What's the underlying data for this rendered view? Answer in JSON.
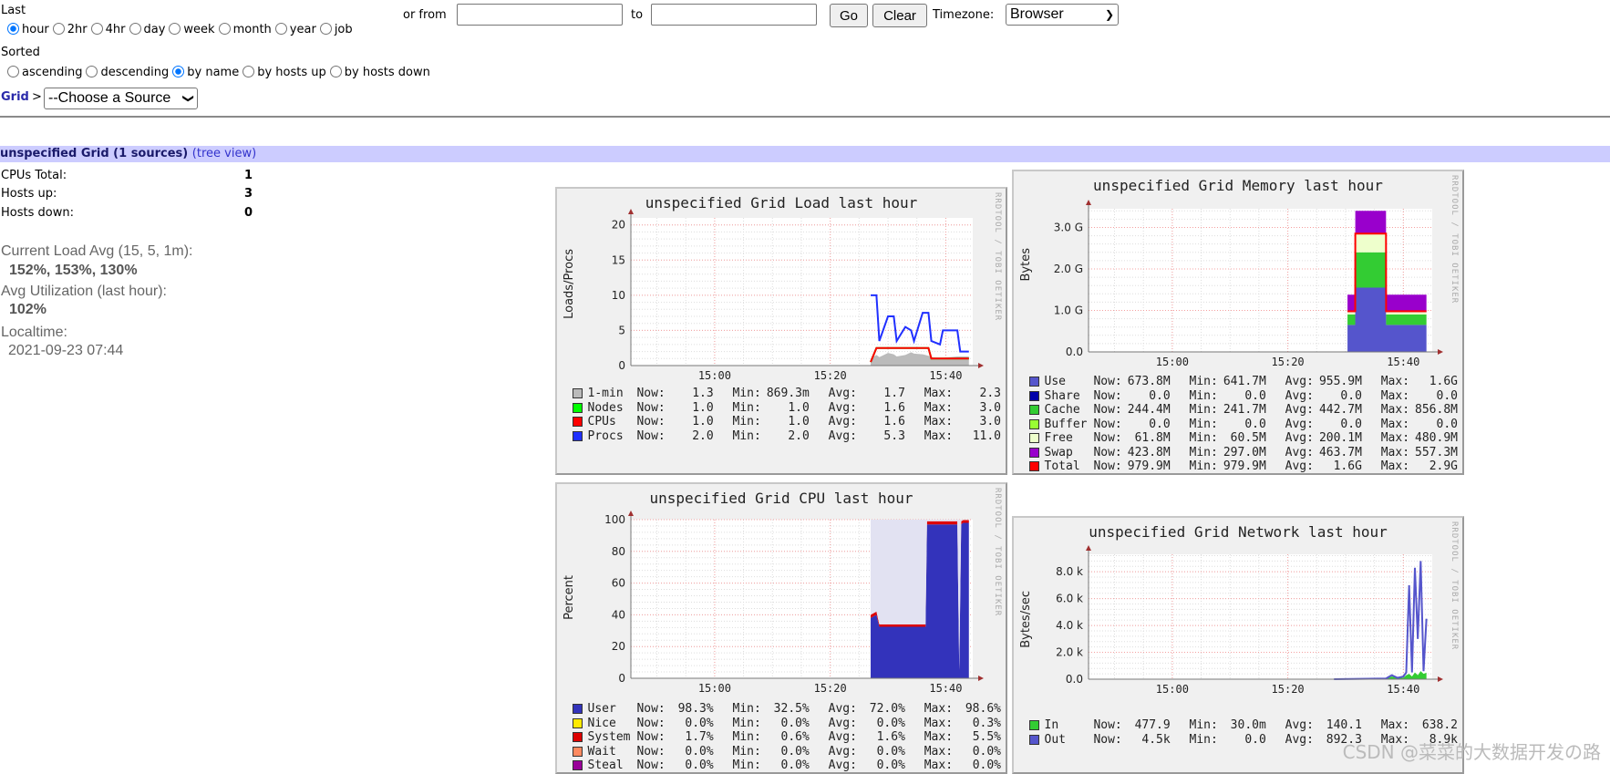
{
  "controls": {
    "last_label": "Last",
    "ranges": [
      {
        "label": "hour",
        "checked": true
      },
      {
        "label": "2hr",
        "checked": false
      },
      {
        "label": "4hr",
        "checked": false
      },
      {
        "label": "day",
        "checked": false
      },
      {
        "label": "week",
        "checked": false
      },
      {
        "label": "month",
        "checked": false
      },
      {
        "label": "year",
        "checked": false
      },
      {
        "label": "job",
        "checked": false
      }
    ],
    "or_from_label": "or from",
    "from_value": "",
    "to_label": "to",
    "to_value": "",
    "go_label": "Go",
    "clear_label": "Clear",
    "timezone_label": "Timezone:",
    "timezone_value": "Browser",
    "sorted_label": "Sorted",
    "sorts": [
      {
        "label": "ascending",
        "checked": false
      },
      {
        "label": "descending",
        "checked": false
      },
      {
        "label": "by name",
        "checked": true
      },
      {
        "label": "by hosts up",
        "checked": false
      },
      {
        "label": "by hosts down",
        "checked": false
      }
    ],
    "grid_link": "Grid",
    "breadcrumb_sep": ">",
    "source_select": "--Choose a Source"
  },
  "grid": {
    "header": "unspecified Grid (1 sources)",
    "tree_view": "(tree view)",
    "stats": [
      {
        "label": "CPUs Total:",
        "value": "1"
      },
      {
        "label": "Hosts up:",
        "value": "3"
      },
      {
        "label": "Hosts down:",
        "value": "0"
      }
    ],
    "load_label": "Current Load Avg (15, 5, 1m):",
    "load_value": "152%, 153%, 130%",
    "util_label": "Avg Utilization (last hour):",
    "util_value": "102%",
    "localtime_label": "Localtime:",
    "localtime_value": "2021-09-23 07:44"
  },
  "graphs": {
    "watermark_side": "RRDTOOL / TOBI OETIKER",
    "legend_labels": {
      "now": "Now:",
      "min": "Min:",
      "avg": "Avg:",
      "max": "Max:"
    },
    "load": {
      "title": "unspecified Grid Load last hour",
      "ylabel": "Loads/Procs",
      "ylim": [
        0,
        21
      ],
      "yticks": [
        "0",
        "5",
        "10",
        "15",
        "20"
      ],
      "ytick_values": [
        0,
        5,
        10,
        15,
        20
      ],
      "xticks": [
        "15:00",
        "15:20",
        "15:40"
      ],
      "xlim": [
        "14:45:30",
        "15:44:40"
      ],
      "times": [
        "15:27",
        "15:28",
        "15:28:30",
        "15:30",
        "15:31",
        "15:31:30",
        "15:33",
        "15:34",
        "15:34:30",
        "15:36",
        "15:37",
        "15:37:30",
        "15:39",
        "15:39:30",
        "15:42",
        "15:42:30",
        "15:44"
      ],
      "series": [
        {
          "name": "1-min",
          "color": "#bbbbbb",
          "style": "area",
          "values": [
            1,
            1.5,
            1.2,
            1.8,
            1.6,
            1.3,
            1.5,
            1.9,
            1.7,
            1.6,
            1.4,
            1.2,
            1,
            1.1,
            1.3,
            1.3,
            1.3
          ]
        },
        {
          "name": "Nodes",
          "color": "#00ff00",
          "style": "line",
          "values": [
            0.5,
            2.5,
            2.5,
            2.5,
            2.5,
            2.5,
            2.5,
            2.5,
            2.5,
            2.5,
            2.5,
            1,
            1,
            1,
            1,
            1,
            1
          ]
        },
        {
          "name": "CPUs",
          "color": "#ff0000",
          "style": "line",
          "values": [
            0.5,
            2.5,
            2.5,
            2.5,
            2.5,
            2.5,
            2.5,
            2.5,
            2.5,
            2.5,
            2.5,
            1,
            1,
            1,
            1,
            1,
            1
          ]
        },
        {
          "name": "Procs",
          "color": "#2030ff",
          "style": "line",
          "values": [
            10,
            10,
            3.5,
            7,
            7,
            3.5,
            5.5,
            5,
            3.5,
            7.5,
            7.5,
            3.5,
            3,
            5,
            5,
            2,
            2
          ]
        }
      ],
      "legend": [
        {
          "name": "1-min",
          "color": "#bbbbbb",
          "now": "1.3",
          "min": "869.3m",
          "avg": "1.7",
          "max": "2.3"
        },
        {
          "name": "Nodes",
          "color": "#00ff00",
          "now": "1.0",
          "min": "1.0",
          "avg": "1.6",
          "max": "3.0"
        },
        {
          "name": "CPUs",
          "color": "#ff0000",
          "now": "1.0",
          "min": "1.0",
          "avg": "1.6",
          "max": "3.0"
        },
        {
          "name": "Procs",
          "color": "#2030ff",
          "now": "2.0",
          "min": "2.0",
          "avg": "5.3",
          "max": "11.0"
        }
      ]
    },
    "memory": {
      "title": "unspecified Grid Memory last hour",
      "ylabel": "Bytes",
      "ylim": [
        0,
        3.45
      ],
      "yticks": [
        "0.0",
        "1.0 G",
        "2.0 G",
        "3.0 G"
      ],
      "ytick_values": [
        0,
        1,
        2,
        3
      ],
      "xticks": [
        "15:00",
        "15:20",
        "15:40"
      ],
      "xlim": [
        "14:45:30",
        "15:45:00"
      ],
      "times": [
        "15:30:20",
        "15:31:40",
        "15:31:41",
        "15:37:00",
        "15:37:01",
        "15:44:00"
      ],
      "series": [
        {
          "name": "Use",
          "color": "#5555cc",
          "style": "stack",
          "values": [
            0.65,
            0.65,
            1.55,
            1.55,
            0.65,
            0.65
          ]
        },
        {
          "name": "Cache",
          "color": "#33cc33",
          "style": "stack",
          "values": [
            0.25,
            0.25,
            0.85,
            0.85,
            0.25,
            0.25
          ]
        },
        {
          "name": "Free",
          "color": "#eeffcc",
          "style": "stack",
          "values": [
            0.06,
            0.06,
            0.45,
            0.45,
            0.06,
            0.06
          ]
        },
        {
          "name": "Swap",
          "color": "#9900cc",
          "style": "stack",
          "values": [
            0.42,
            0.42,
            0.55,
            0.55,
            0.42,
            0.42
          ]
        },
        {
          "name": "Total",
          "color": "#ff0000",
          "style": "line",
          "values": [
            0.98,
            0.98,
            2.85,
            2.85,
            0.98,
            0.98
          ]
        }
      ],
      "legend": [
        {
          "name": "Use",
          "color": "#5555cc",
          "now": "673.8M",
          "min": "641.7M",
          "avg": "955.9M",
          "max": "1.6G"
        },
        {
          "name": "Share",
          "color": "#0000aa",
          "now": "0.0",
          "min": "0.0",
          "avg": "0.0",
          "max": "0.0"
        },
        {
          "name": "Cache",
          "color": "#33cc33",
          "now": "244.4M",
          "min": "241.7M",
          "avg": "442.7M",
          "max": "856.8M"
        },
        {
          "name": "Buffer",
          "color": "#99ff33",
          "now": "0.0",
          "min": "0.0",
          "avg": "0.0",
          "max": "0.0"
        },
        {
          "name": "Free",
          "color": "#eeffcc",
          "now": "61.8M",
          "min": "60.5M",
          "avg": "200.1M",
          "max": "480.9M"
        },
        {
          "name": "Swap",
          "color": "#9900cc",
          "now": "423.8M",
          "min": "297.0M",
          "avg": "463.7M",
          "max": "557.3M"
        },
        {
          "name": "Total",
          "color": "#ff0000",
          "now": "979.9M",
          "min": "979.9M",
          "avg": "1.6G",
          "max": "2.9G"
        }
      ]
    },
    "cpu": {
      "title": "unspecified Grid CPU last hour",
      "ylabel": "Percent",
      "ylim": [
        0,
        100
      ],
      "yticks": [
        "0",
        "20",
        "40",
        "60",
        "80",
        "100"
      ],
      "ytick_values": [
        0,
        20,
        40,
        60,
        80,
        100
      ],
      "xticks": [
        "15:00",
        "15:20",
        "15:40"
      ],
      "xlim": [
        "14:45:30",
        "15:44:40"
      ],
      "times": [
        "15:27",
        "15:28",
        "15:28:30",
        "15:36:30",
        "15:36:45",
        "15:42",
        "15:42:20",
        "15:42:40",
        "15:43",
        "15:44"
      ],
      "series": [
        {
          "name": "User",
          "color": "#3333bb",
          "style": "stack",
          "values": [
            38,
            40,
            32.5,
            32.5,
            97,
            97,
            5,
            97,
            98,
            98
          ]
        },
        {
          "name": "System",
          "color": "#dd0000",
          "style": "stack",
          "values": [
            2,
            2,
            1.5,
            1.5,
            2,
            2,
            0.5,
            2,
            1.7,
            1.7
          ]
        },
        {
          "name": "Idle",
          "color": "#e2e2f2",
          "style": "stack",
          "values": [
            60,
            58,
            66,
            66,
            1,
            1,
            94.5,
            1,
            0.3,
            0.3
          ]
        }
      ],
      "legend": [
        {
          "name": "User",
          "color": "#3333bb",
          "now": "98.3%",
          "min": "32.5%",
          "avg": "72.0%",
          "max": "98.6%"
        },
        {
          "name": "Nice",
          "color": "#ffea00",
          "now": "0.0%",
          "min": "0.0%",
          "avg": "0.0%",
          "max": "0.3%"
        },
        {
          "name": "System",
          "color": "#dd0000",
          "now": "1.7%",
          "min": "0.6%",
          "avg": "1.6%",
          "max": "5.5%"
        },
        {
          "name": "Wait",
          "color": "#ff8a60",
          "now": "0.0%",
          "min": "0.0%",
          "avg": "0.0%",
          "max": "0.0%"
        },
        {
          "name": "Steal",
          "color": "#990099",
          "now": "0.0%",
          "min": "0.0%",
          "avg": "0.0%",
          "max": "0.0%"
        }
      ]
    },
    "network": {
      "title": "unspecified Grid Network last hour",
      "ylabel": "Bytes/sec",
      "ylim": [
        0,
        9.3
      ],
      "yticks": [
        "0.0",
        "2.0 k",
        "4.0 k",
        "6.0 k",
        "8.0 k"
      ],
      "ytick_values": [
        0,
        2,
        4,
        6,
        8
      ],
      "xticks": [
        "15:00",
        "15:20",
        "15:40"
      ],
      "xlim": [
        "14:45:30",
        "15:45:00"
      ],
      "times": [
        "15:28",
        "15:37",
        "15:38",
        "15:39",
        "15:40",
        "15:40:30",
        "15:41",
        "15:41:30",
        "15:42",
        "15:42:30",
        "15:43",
        "15:43:30",
        "15:44"
      ],
      "series": [
        {
          "name": "In",
          "color": "#33cc33",
          "style": "area",
          "values": [
            0,
            0.05,
            0.2,
            0.1,
            0.1,
            0.3,
            0.4,
            0.2,
            0.5,
            0.3,
            0.6,
            0.4,
            0.48
          ]
        },
        {
          "name": "Out",
          "color": "#5555cc",
          "style": "line",
          "values": [
            0,
            0.05,
            0.3,
            0.1,
            0.2,
            0.5,
            7.0,
            0.5,
            8.3,
            3,
            8.8,
            0.6,
            4.5
          ]
        }
      ],
      "legend": [
        {
          "name": "In",
          "color": "#33cc33",
          "now": "477.9",
          "min": "30.0m",
          "avg": "140.1",
          "max": "638.2"
        },
        {
          "name": "Out",
          "color": "#5555cc",
          "now": "4.5k",
          "min": "0.0",
          "avg": "892.3",
          "max": "8.9k"
        }
      ]
    }
  },
  "watermark": "CSDN @菜菜的大数据开发の路"
}
